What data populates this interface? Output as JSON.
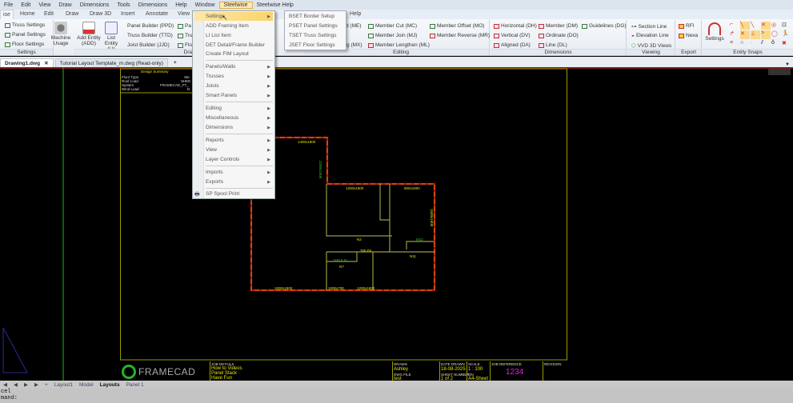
{
  "menubar": [
    "File",
    "Edit",
    "View",
    "Draw",
    "Dimensions",
    "Tools",
    "Dimensions",
    "Help",
    "Window",
    "Steelwise",
    "Steelwise Help"
  ],
  "ribbon_tabs": [
    "ise",
    "Home",
    "Edit",
    "Draw",
    "Draw 3D",
    "Insert",
    "Annotate",
    "View",
    "Help"
  ],
  "ribbon": {
    "settings": {
      "items": [
        "Truss Settings",
        "Panel Settings",
        "Floor Settings"
      ],
      "machine": "Machine Usage",
      "label": "Settings"
    },
    "draw": {
      "add": "Add Entity (ADD)",
      "list": "List Entity (LI)",
      "items": [
        "Panel Builder (PPD)",
        "Truss Builder (TTD)",
        "Joist Builder (JJD)"
      ],
      "partial": [
        "Pa",
        "Tru",
        "Flo"
      ],
      "label": "Dra"
    },
    "editing": {
      "items": [
        "d (ME)",
        "ing (MX)",
        "Member Cut (MC)",
        "Member Join (MJ)",
        "Member Lengthen (ML)",
        "Member Offset (MO)",
        "Member Reverse (MR)"
      ],
      "label": "Editing"
    },
    "dimensions": {
      "items": [
        "Horizontal (DH)",
        "Vertical (DV)",
        "Aligned (DA)",
        "Member (DM)",
        "Ordinate (DO)",
        "Line (DL)",
        "Guidelines (DG)"
      ],
      "label": "Dimensions"
    },
    "viewing": {
      "items": [
        "Section Line",
        "Elevation Line",
        "VVD 3D Views"
      ],
      "label": "Viewing"
    },
    "export": {
      "items": [
        "RFI",
        "Nexa"
      ],
      "label": "Export"
    },
    "snaps": {
      "settings": "Settings",
      "label": "Entity Snaps"
    }
  },
  "doc_tabs": [
    "Drawing1.dwg",
    "Tutorial Layout Template_m.dwg (Read-only)"
  ],
  "dropdown": {
    "items": [
      "Settings",
      "ADD Framing Item",
      "LI List Item",
      "DET Detail/Frame Builder",
      "Create FIM Layout",
      "Panels/Walls",
      "Trusses",
      "Joists",
      "Smart Panels",
      "Editing",
      "Miscellaneous",
      "Dimensions",
      "Reports",
      "View",
      "Layer Controls",
      "Imports",
      "Exports",
      "SP Spool Print"
    ]
  },
  "submenu": [
    "BSET  Border Setup",
    "PSET Panel Settings",
    "TSET Truss Settings",
    "JSET Floor Settings"
  ],
  "design_summary": {
    "title": "Design Summary",
    "rows": [
      [
        "Floor Type",
        "Ste"
      ],
      [
        "Roof Load",
        "SHEE"
      ],
      [
        "System",
        "FRAMECAD_FT_"
      ],
      [
        "Wind Load",
        "N"
      ]
    ]
  },
  "plan_labels": [
    "1400x1800",
    "1200x1800",
    "900x1800",
    "2200x1800",
    "1500x1800",
    "1000x1800",
    "1000x700",
    "1200x1800",
    "N2",
    "M12",
    "N11",
    "N7",
    "700 P4",
    "2x810 Sr"
  ],
  "title_block": {
    "logo": "FRAMECAD",
    "job_details_label": "JOB DETAILS",
    "job_details": [
      "How to Videos",
      "Panel Stack",
      "Have Fun"
    ],
    "drawn_label": "DRAWN",
    "drawn": "Ashley",
    "dwg_file_label": "DWG FILE",
    "dwg_file": "test",
    "date_label": "DATE DRAWN",
    "date": "18-08-2025",
    "sheet_label": "SHEET NUMBER",
    "sheet": "1 of 2",
    "scale_label": "SCALE",
    "scale": "1 : 100",
    "on_label": "ON",
    "on": "A4-Sheet",
    "job_ref_label": "JOB REFERENCE",
    "job_ref": "1234",
    "revision_label": "REVISION"
  },
  "layout_tabs": [
    "Layout1",
    "Model",
    "Layouts",
    "Panel 1"
  ],
  "command": [
    "cel",
    "mand:"
  ],
  "colors": {
    "accent": "#fcd36a",
    "paper_border": "#c8c800",
    "wall": "#d01010",
    "member": "#c8c800",
    "job_ref": "#e020e0"
  }
}
